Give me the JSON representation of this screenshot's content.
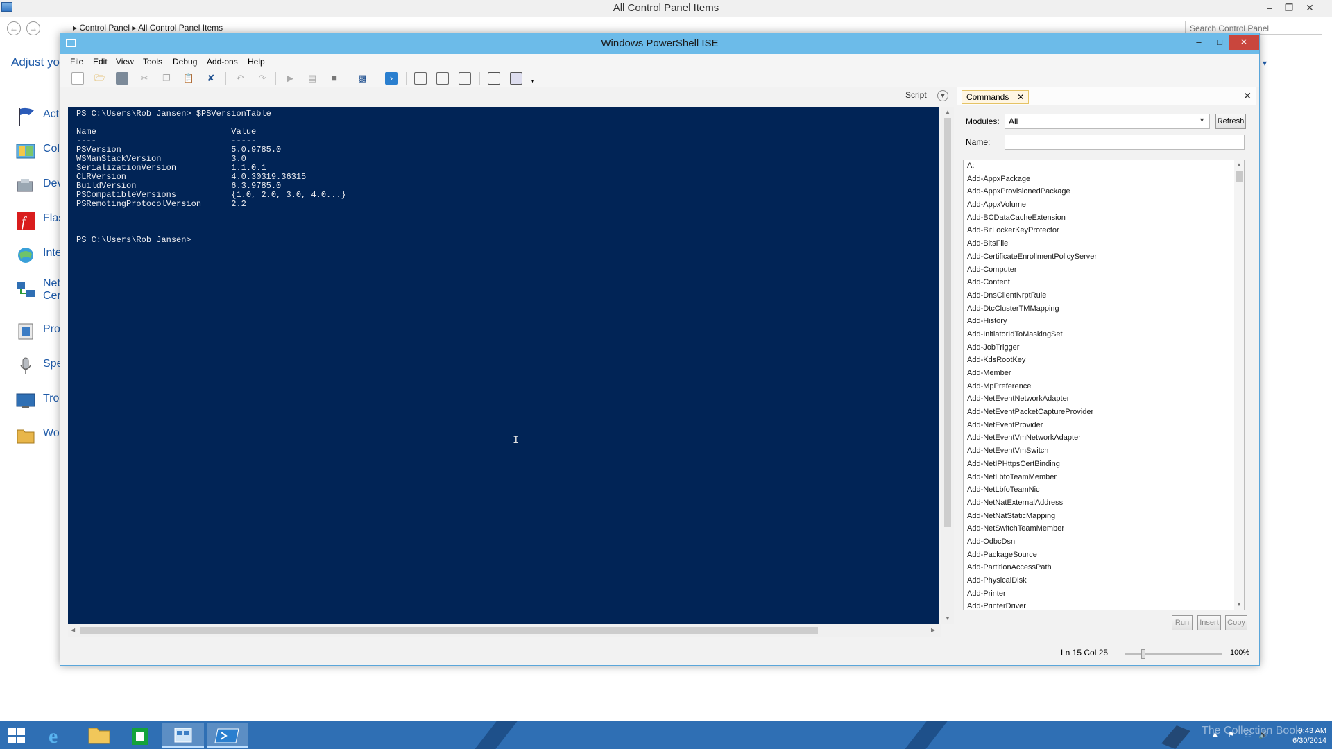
{
  "control_panel": {
    "title": "All Control Panel Items",
    "breadcrumb": "▸ Control Panel ▸ All Control Panel Items",
    "search_placeholder": "Search Control Panel",
    "heading": "Adjust you",
    "items": [
      {
        "label": "Acti",
        "icon": "flag-icon"
      },
      {
        "label": "Col",
        "icon": "color-icon"
      },
      {
        "label": "Dev",
        "icon": "device-icon"
      },
      {
        "label": "Flas",
        "icon": "flash-icon"
      },
      {
        "label": "Inte",
        "icon": "internet-icon"
      },
      {
        "label": "Net\nCer",
        "icon": "network-icon"
      },
      {
        "label": "Pro",
        "icon": "programs-icon"
      },
      {
        "label": "Spe",
        "icon": "microphone-icon"
      },
      {
        "label": "Tro",
        "icon": "troubleshoot-icon"
      },
      {
        "label": "Wo",
        "icon": "folder-icon"
      }
    ]
  },
  "ise": {
    "title": "Windows PowerShell ISE",
    "menu": [
      "File",
      "Edit",
      "View",
      "Tools",
      "Debug",
      "Add-ons",
      "Help"
    ],
    "script_tab_label": "Script",
    "console_lines": [
      "PS C:\\Users\\Rob Jansen> $PSVersionTable",
      "",
      "Name                           Value",
      "----                           -----",
      "PSVersion                      5.0.9785.0",
      "WSManStackVersion              3.0",
      "SerializationVersion           1.1.0.1",
      "CLRVersion                     4.0.30319.36315",
      "BuildVersion                   6.3.9785.0",
      "PSCompatibleVersions           {1.0, 2.0, 3.0, 4.0...}",
      "PSRemotingProtocolVersion      2.2",
      "",
      "",
      "",
      "PS C:\\Users\\Rob Jansen>"
    ],
    "commands": {
      "tab_label": "Commands",
      "modules_label": "Modules:",
      "modules_value": "All",
      "refresh_label": "Refresh",
      "name_label": "Name:",
      "list": [
        "A:",
        "Add-AppxPackage",
        "Add-AppxProvisionedPackage",
        "Add-AppxVolume",
        "Add-BCDataCacheExtension",
        "Add-BitLockerKeyProtector",
        "Add-BitsFile",
        "Add-CertificateEnrollmentPolicyServer",
        "Add-Computer",
        "Add-Content",
        "Add-DnsClientNrptRule",
        "Add-DtcClusterTMMapping",
        "Add-History",
        "Add-InitiatorIdToMaskingSet",
        "Add-JobTrigger",
        "Add-KdsRootKey",
        "Add-Member",
        "Add-MpPreference",
        "Add-NetEventNetworkAdapter",
        "Add-NetEventPacketCaptureProvider",
        "Add-NetEventProvider",
        "Add-NetEventVmNetworkAdapter",
        "Add-NetEventVmSwitch",
        "Add-NetIPHttpsCertBinding",
        "Add-NetLbfoTeamMember",
        "Add-NetLbfoTeamNic",
        "Add-NetNatExternalAddress",
        "Add-NetNatStaticMapping",
        "Add-NetSwitchTeamMember",
        "Add-OdbcDsn",
        "Add-PackageSource",
        "Add-PartitionAccessPath",
        "Add-PhysicalDisk",
        "Add-Printer",
        "Add-PrinterDriver"
      ],
      "run_label": "Run",
      "insert_label": "Insert",
      "copy_label": "Copy"
    },
    "status": {
      "position": "Ln 15  Col 25",
      "zoom": "100%"
    }
  },
  "taskbar": {
    "watermark": "The Collection Book",
    "time": "9:43 AM",
    "date": "6/30/2014"
  }
}
